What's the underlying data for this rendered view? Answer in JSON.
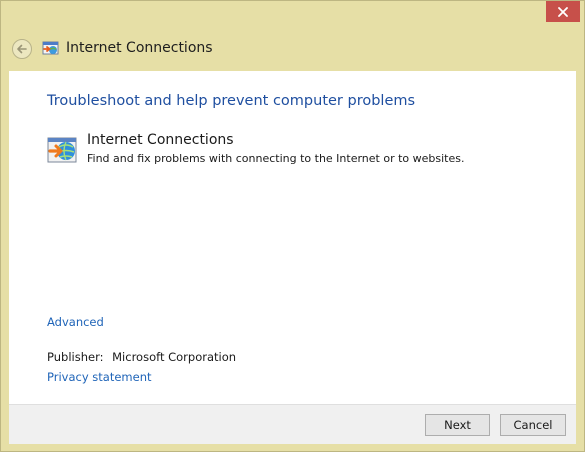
{
  "window": {
    "title": "Internet Connections",
    "title_icon": "troubleshooter-icon",
    "frame_color": "#e6dfa6",
    "close_color": "#c7504a"
  },
  "main": {
    "heading": "Troubleshoot and help prevent computer problems",
    "item": {
      "icon": "internet-globe-arrow-icon",
      "title": "Internet Connections",
      "description": "Find and fix problems with connecting to the Internet or to websites."
    },
    "advanced_link": "Advanced",
    "publisher_label": "Publisher:",
    "publisher_value": "Microsoft Corporation",
    "privacy_link": "Privacy statement",
    "link_color": "#1f64b8",
    "heading_color": "#1f4fa0"
  },
  "footer": {
    "next_label": "Next",
    "cancel_label": "Cancel"
  }
}
